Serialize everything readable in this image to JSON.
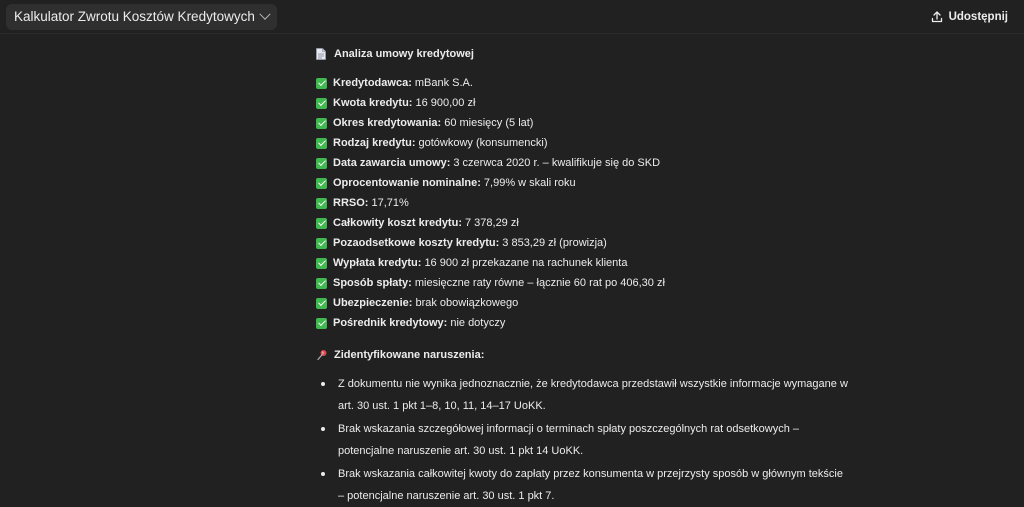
{
  "header": {
    "title": "Kalkulator Zwrotu Kosztów Kredytowych",
    "share_label": "Udostępnij"
  },
  "analysis": {
    "heading": "Analiza umowy kredytowej",
    "items": [
      {
        "label": "Kredytodawca:",
        "value": "mBank S.A."
      },
      {
        "label": "Kwota kredytu:",
        "value": "16 900,00 zł"
      },
      {
        "label": "Okres kredytowania:",
        "value": "60 miesięcy (5 lat)"
      },
      {
        "label": "Rodzaj kredytu:",
        "value": "gotówkowy (konsumencki)"
      },
      {
        "label": "Data zawarcia umowy:",
        "value": "3 czerwca 2020 r. – kwalifikuje się do SKD"
      },
      {
        "label": "Oprocentowanie nominalne:",
        "value": "7,99% w skali roku"
      },
      {
        "label": "RRSO:",
        "value": "17,71%"
      },
      {
        "label": "Całkowity koszt kredytu:",
        "value": "7 378,29 zł"
      },
      {
        "label": "Pozaodsetkowe koszty kredytu:",
        "value": "3 853,29 zł (prowizja)"
      },
      {
        "label": "Wypłata kredytu:",
        "value": "16 900 zł przekazane na rachunek klienta"
      },
      {
        "label": "Sposób spłaty:",
        "value": "miesięczne raty równe – łącznie 60 rat po 406,30 zł"
      },
      {
        "label": "Ubezpieczenie:",
        "value": "brak obowiązkowego"
      },
      {
        "label": "Pośrednik kredytowy:",
        "value": "nie dotyczy"
      }
    ]
  },
  "violations": {
    "heading": "Zidentyfikowane naruszenia:",
    "items": [
      {
        "line1": "Z dokumentu nie wynika jednoznacznie, że kredytodawca przedstawił wszystkie informacje wymagane w",
        "line2": "art. 30 ust. 1 pkt 1–8, 10, 11, 14–17 UoKK."
      },
      {
        "line1": "Brak wskazania szczegółowej informacji o terminach spłaty poszczególnych rat odsetkowych –",
        "line2": "potencjalne naruszenie art. 30 ust. 1 pkt 14 UoKK."
      },
      {
        "line1": "Brak wskazania całkowitej kwoty do zapłaty przez konsumenta w przejrzysty sposób w głównym tekście",
        "line2": "– potencjalne naruszenie art. 30 ust. 1 pkt 7."
      }
    ]
  },
  "icons": {
    "title_dropdown": "chevron-down-icon",
    "share": "share-upload-icon",
    "heading": "document-icon",
    "check": "check-box-icon",
    "violations": "pushpin-icon"
  },
  "colors": {
    "background": "#212121",
    "check_green": "#3fb950",
    "pin_red": "#e0474c"
  }
}
